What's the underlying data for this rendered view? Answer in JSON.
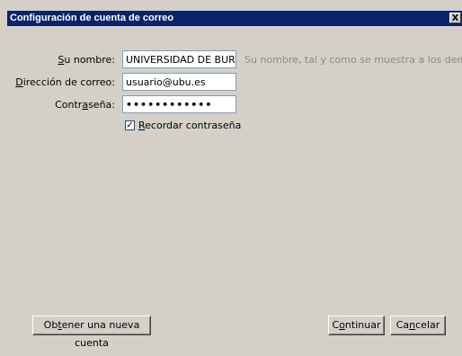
{
  "window": {
    "title": "Configuración de cuenta de correo",
    "close_label": "X"
  },
  "form": {
    "name": {
      "label_pre": "",
      "label_key": "S",
      "label_post": "u nombre:",
      "value": "UNIVERSIDAD DE BURGOS",
      "hint": "Su nombre, tal y como se muestra a los demás"
    },
    "email": {
      "label_pre": "",
      "label_key": "D",
      "label_post": "irección de correo:",
      "value": "usuario@ubu.es"
    },
    "password": {
      "label_pre": "Contr",
      "label_key": "a",
      "label_post": "seña:",
      "value": "••••••••••••"
    },
    "remember": {
      "checked_mark": "✓",
      "label_pre": "",
      "label_key": "R",
      "label_post": "ecordar contraseña",
      "checked": true
    }
  },
  "buttons": {
    "new_account": {
      "pre": "Ob",
      "key": "t",
      "post": "ener una nueva cuenta"
    },
    "continue": {
      "pre": "C",
      "key": "o",
      "post": "ntinuar"
    },
    "cancel": {
      "pre": "Ca",
      "key": "n",
      "post": "celar"
    }
  }
}
